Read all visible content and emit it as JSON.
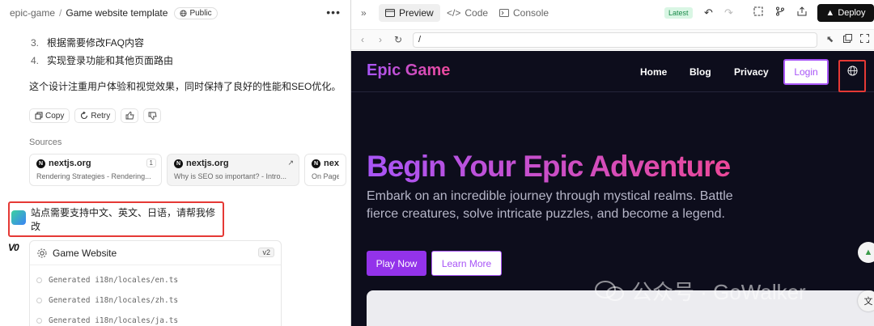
{
  "left": {
    "breadcrumb": {
      "project": "epic-game",
      "separator": "/",
      "title": "Game website template",
      "visibility": "Public"
    },
    "list_items": [
      {
        "num": "3.",
        "text": "根据需要修改FAQ内容"
      },
      {
        "num": "4.",
        "text": "实现登录功能和其他页面路由"
      }
    ],
    "summary": "这个设计注重用户体验和视觉效果，同时保持了良好的性能和SEO优化。",
    "actions": {
      "copy": "Copy",
      "retry": "Retry"
    },
    "sources_label": "Sources",
    "sources": [
      {
        "host": "nextjs.org",
        "badge": "1",
        "snippet": "Rendering Strategies - Rendering..."
      },
      {
        "host": "nextjs.org",
        "badge": "↗",
        "snippet": "Why is SEO so important? - Intro..."
      },
      {
        "host": "nex",
        "badge": "",
        "snippet": "On Page"
      }
    ],
    "user_message": "站点需要支持中文、英文、日语，请帮我修改",
    "card": {
      "title": "Game Website",
      "version": "v2",
      "generated": [
        "Generated i18n/locales/en.ts",
        "Generated i18n/locales/zh.ts",
        "Generated i18n/locales/ja.ts"
      ]
    }
  },
  "right": {
    "tabs": {
      "preview": "Preview",
      "code": "Code",
      "console": "Console"
    },
    "latest": "Latest",
    "deploy": "Deploy",
    "url": "/",
    "site": {
      "logo": "Epic Game",
      "nav": {
        "home": "Home",
        "blog": "Blog",
        "privacy": "Privacy",
        "login": "Login"
      },
      "hero_title": "Begin Your Epic Adventure",
      "hero_subtitle": "Embark on an incredible journey through mystical realms. Battle fierce creatures, solve intricate puzzles, and become a legend.",
      "play_button": "Play Now",
      "learn_button": "Learn More"
    },
    "watermark": "公众号 · GoWalker"
  },
  "colors": {
    "accent_purple": "#a855f7",
    "accent_pink": "#ec4899",
    "highlight_red": "#e53935",
    "site_bg": "#0d0d1c"
  }
}
